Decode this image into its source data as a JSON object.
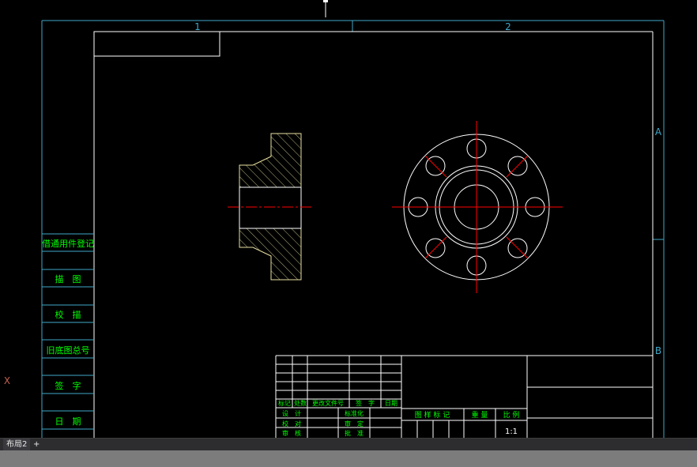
{
  "zone_labels": {
    "col1": "1",
    "col2": "2",
    "rowA": "A",
    "rowB": "B"
  },
  "side_table": [
    "借通用件登记",
    "描　图",
    "校　描",
    "旧底图总号",
    "签　字",
    "日　期"
  ],
  "revision_headers": [
    "标记",
    "处数",
    "更改文件号",
    "签　字",
    "日期"
  ],
  "signature_rows": [
    "设　计",
    "校　对",
    "审　核"
  ],
  "signature_rows_right": [
    "标准化",
    "审　定",
    "批　准"
  ],
  "title_block": {
    "drawing_mark": "图 样 标 记",
    "weight": "重 量",
    "scale_label": "比 例",
    "scale_value": "1:1"
  },
  "ucs_icon": "X",
  "tabs": {
    "layout2": "布局2",
    "add": "+"
  },
  "colors": {
    "frame": "#3fa9c8",
    "paper": "#ffffff",
    "table_text": "#00ff00",
    "centerline": "#ff0000",
    "hatch": "#e8e0a0",
    "ucs": "#c06050"
  }
}
